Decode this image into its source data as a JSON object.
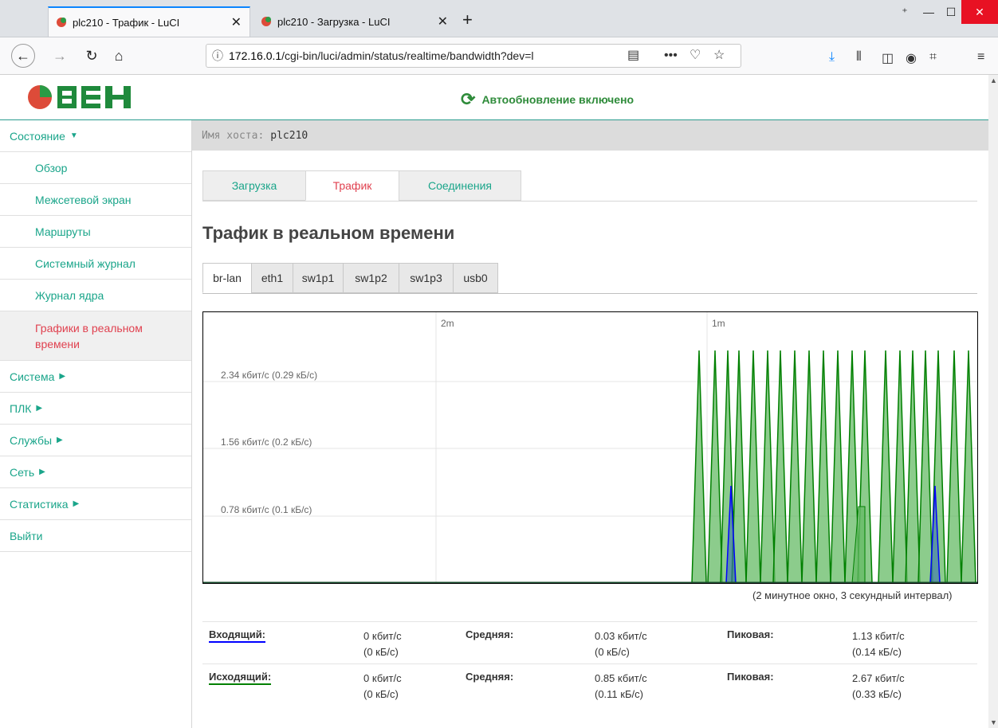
{
  "browser": {
    "tabs": [
      {
        "title": "plc210 - Трафик - LuCI",
        "active": true
      },
      {
        "title": "plc210 - Загрузка - LuCI",
        "active": false
      }
    ],
    "url_host": "172.16.0.1",
    "url_path": "/cgi-bin/luci/admin/status/realtime/bandwidth?dev=l"
  },
  "header": {
    "logo_text": "ОВЕН",
    "autorefresh_label": "Автообновление включено"
  },
  "sidebar": {
    "items": [
      {
        "label": "Состояние",
        "level": 0,
        "expanded": true
      },
      {
        "label": "Обзор",
        "level": 1
      },
      {
        "label": "Межсетевой экран",
        "level": 1
      },
      {
        "label": "Маршруты",
        "level": 1
      },
      {
        "label": "Системный журнал",
        "level": 1
      },
      {
        "label": "Журнал ядра",
        "level": 1
      },
      {
        "label": "Графики в реальном времени",
        "level": 1,
        "active": true
      },
      {
        "label": "Система",
        "level": 0
      },
      {
        "label": "ПЛК",
        "level": 0
      },
      {
        "label": "Службы",
        "level": 0
      },
      {
        "label": "Сеть",
        "level": 0
      },
      {
        "label": "Статистика",
        "level": 0
      },
      {
        "label": "Выйти",
        "level": 0
      }
    ]
  },
  "hostname": {
    "label": "Имя хоста:",
    "value": "plc210"
  },
  "main_tabs": [
    {
      "label": "Загрузка"
    },
    {
      "label": "Трафик",
      "active": true
    },
    {
      "label": "Соединения"
    }
  ],
  "page_title": "Трафик в реальном времени",
  "interface_tabs": [
    {
      "label": "br-lan",
      "active": true
    },
    {
      "label": "eth1"
    },
    {
      "label": "sw1p1"
    },
    {
      "label": "sw1p2"
    },
    {
      "label": "sw1p3"
    },
    {
      "label": "usb0"
    }
  ],
  "graph": {
    "y_labels": [
      "2.34 кбит/с (0.29 кБ/с)",
      "1.56 кбит/с (0.2 кБ/с)",
      "0.78 кбит/с (0.1 кБ/с)"
    ],
    "time_labels": [
      "2m",
      "1m"
    ],
    "window_note": "(2 минутное окно, 3 секундный интервал)",
    "colors": {
      "incoming": "#0000ff",
      "outgoing": "#008000",
      "outgoing_fill": "#66bb66"
    }
  },
  "stats": {
    "rows": [
      {
        "label": "Входящий:",
        "current": "0 кбит/с",
        "current_bytes": "(0 кБ/с)",
        "avg_label": "Средняя:",
        "avg": "0.03 кбит/с",
        "avg_bytes": "(0 кБ/с)",
        "peak_label": "Пиковая:",
        "peak": "1.13 кбит/с",
        "peak_bytes": "(0.14 кБ/с)"
      },
      {
        "label": "Исходящий:",
        "current": "0 кбит/с",
        "current_bytes": "(0 кБ/с)",
        "avg_label": "Средняя:",
        "avg": "0.85 кбит/с",
        "avg_bytes": "(0.11 кБ/с)",
        "peak_label": "Пиковая:",
        "peak": "2.67 кбит/с",
        "peak_bytes": "(0.33 кБ/с)"
      }
    ]
  }
}
